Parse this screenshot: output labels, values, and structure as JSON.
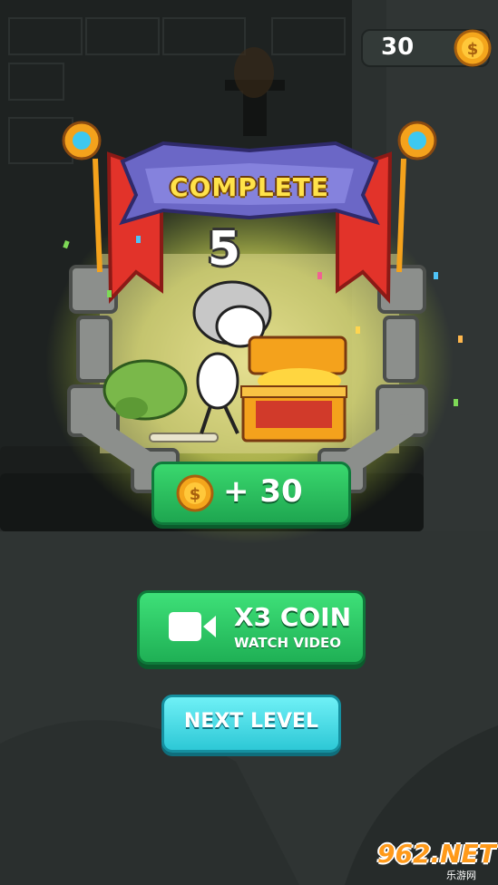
{
  "hud": {
    "coins": "30"
  },
  "result": {
    "title": "COMPLETE",
    "level": "5",
    "reward": "+ 30"
  },
  "buttons": {
    "x3_title": "X3 COIN",
    "x3_sub": "WATCH VIDEO",
    "next": "NEXT LEVEL"
  },
  "watermark": {
    "logo": "962.NET",
    "sub": "乐游网"
  },
  "colors": {
    "green_button": "#2cc863",
    "cyan_button": "#4fdde6",
    "banner_purple": "#6b67c6",
    "banner_red": "#e2332a",
    "coin_gold": "#f4a61c",
    "title_yellow": "#ffe24a"
  },
  "icons": [
    "coin-icon",
    "video-camera-icon",
    "treasure-chest",
    "stickman-knight",
    "goblin"
  ]
}
